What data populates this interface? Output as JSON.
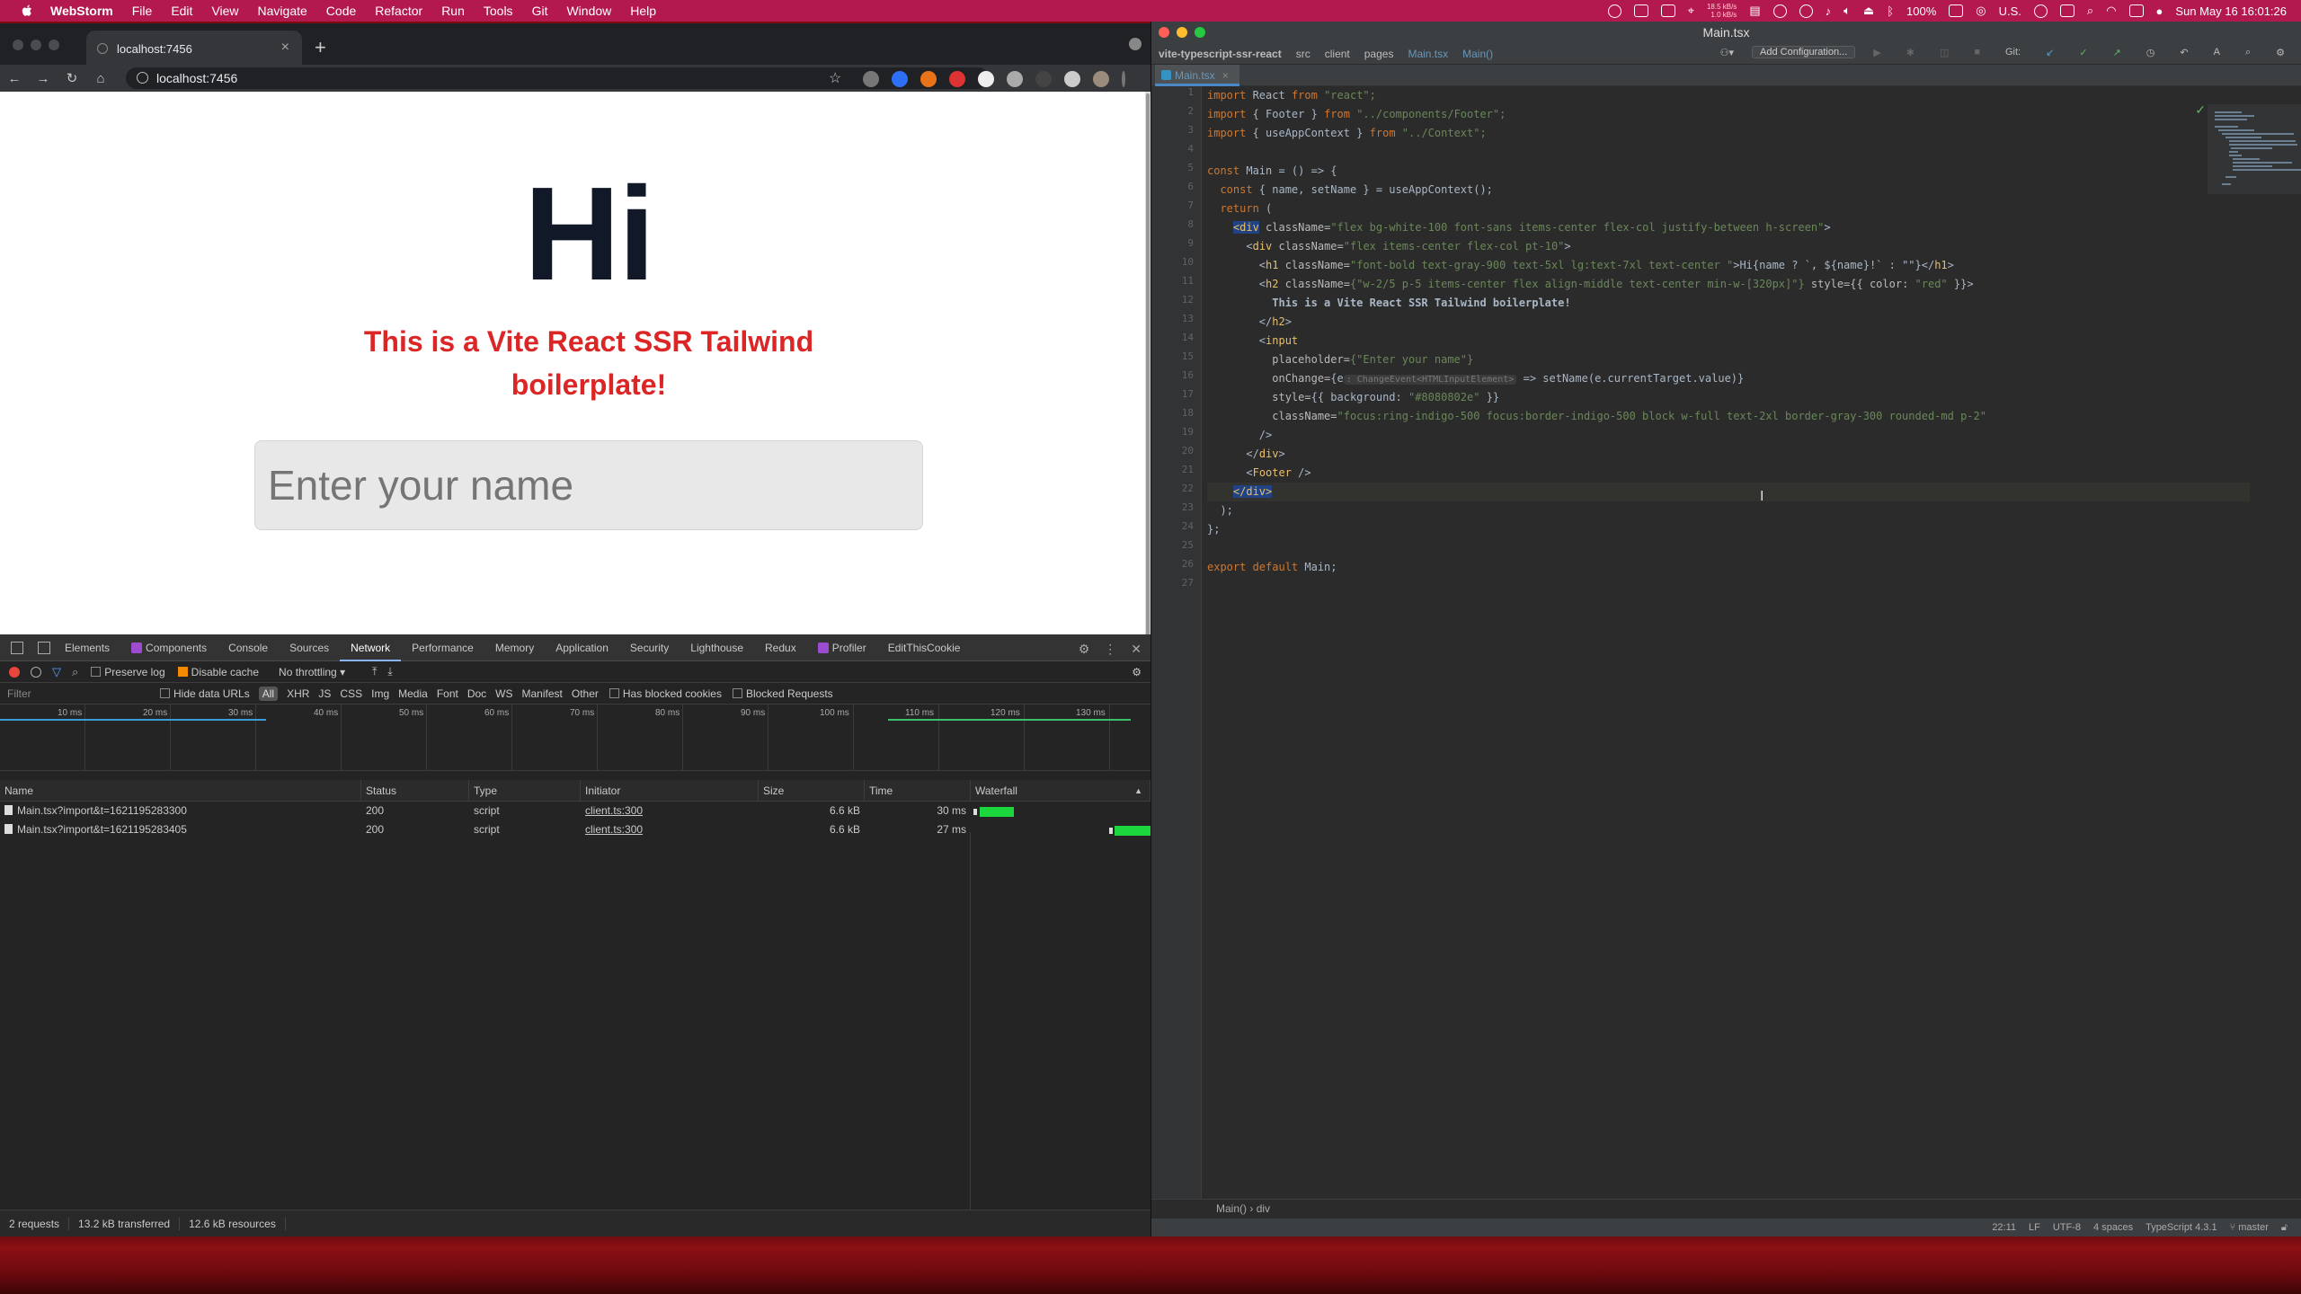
{
  "menubar": {
    "app": "WebStorm",
    "items": [
      "File",
      "Edit",
      "View",
      "Navigate",
      "Code",
      "Refactor",
      "Run",
      "Tools",
      "Git",
      "Window",
      "Help"
    ],
    "net_speed": [
      "18.5 kB/s",
      "1.0 kB/s"
    ],
    "battery": "100%",
    "input_source": "U.S.",
    "clock": "Sun May 16 16:01:26"
  },
  "browser": {
    "tab_title": "localhost:7456",
    "url": "localhost:7456",
    "page": {
      "heading": "Hi",
      "subheading": "This is a Vite React SSR Tailwind boilerplate!",
      "input_placeholder": "Enter your name",
      "input_background": "#8080802e"
    }
  },
  "devtools": {
    "tabs": [
      "Elements",
      "Components",
      "Console",
      "Sources",
      "Network",
      "Performance",
      "Memory",
      "Application",
      "Security",
      "Lighthouse",
      "Redux",
      "Profiler",
      "EditThisCookie"
    ],
    "active_tab": "Network",
    "controls": {
      "preserve_log": "Preserve log",
      "disable_cache": "Disable cache",
      "throttling": "No throttling"
    },
    "filter": {
      "placeholder": "Filter",
      "hide_data_urls": "Hide data URLs",
      "types": [
        "All",
        "XHR",
        "JS",
        "CSS",
        "Img",
        "Media",
        "Font",
        "Doc",
        "WS",
        "Manifest",
        "Other"
      ],
      "has_blocked_cookies": "Has blocked cookies",
      "blocked_requests": "Blocked Requests"
    },
    "timeline_ticks": [
      "10 ms",
      "20 ms",
      "30 ms",
      "40 ms",
      "50 ms",
      "60 ms",
      "70 ms",
      "80 ms",
      "90 ms",
      "100 ms",
      "110 ms",
      "120 ms",
      "130 ms"
    ],
    "columns": [
      "Name",
      "Status",
      "Type",
      "Initiator",
      "Size",
      "Time",
      "Waterfall"
    ],
    "requests": [
      {
        "name": "Main.tsx?import&t=1621195283300",
        "status": "200",
        "type": "script",
        "initiator": "client.ts:300",
        "size": "6.6 kB",
        "time": "30 ms"
      },
      {
        "name": "Main.tsx?import&t=1621195283405",
        "status": "200",
        "type": "script",
        "initiator": "client.ts:300",
        "size": "6.6 kB",
        "time": "27 ms"
      }
    ],
    "status": {
      "requests": "2 requests",
      "transferred": "13.2 kB transferred",
      "resources": "12.6 kB resources"
    }
  },
  "ide": {
    "window_title": "Main.tsx",
    "breadcrumbs": [
      "vite-typescript-ssr-react",
      "src",
      "client",
      "pages",
      "Main.tsx",
      "Main()"
    ],
    "add_configuration": "Add Configuration...",
    "git_label": "Git:",
    "file_tab": "Main.tsx",
    "line_numbers": [
      "1",
      "2",
      "3",
      "4",
      "5",
      "6",
      "7",
      "8",
      "9",
      "10",
      "11",
      "12",
      "13",
      "14",
      "15",
      "16",
      "17",
      "18",
      "19",
      "20",
      "21",
      "22",
      "23",
      "24",
      "25",
      "26",
      "27"
    ],
    "bottom_breadcrumb": [
      "Main()",
      "div"
    ],
    "status": {
      "position": "22:11",
      "line_sep": "LF",
      "encoding": "UTF-8",
      "indent": "4 spaces",
      "language": "TypeScript 4.3.1",
      "branch": "master"
    }
  },
  "code": {
    "l1": {
      "kw": "import",
      "id": " React ",
      "from": "from",
      "str": " \"react\";"
    },
    "l2": {
      "kw": "import",
      "id": " { Footer } ",
      "from": "from",
      "str": " \"../components/Footer\";"
    },
    "l3": {
      "kw": "import",
      "id": " { useAppContext } ",
      "from": "from",
      "str": " \"../Context\";"
    },
    "l5": {
      "kw": "const",
      "rest": " Main = () => {"
    },
    "l6": {
      "kw": "const",
      "rest": " { name, setName } = useAppContext();"
    },
    "l7": {
      "kw": "return",
      "rest": " ("
    },
    "l8": {
      "open": "<",
      "tag": "div",
      "attr": " className=",
      "val": "\"flex bg-white-100 font-sans items-center flex-col justify-between h-screen\"",
      "close": ">"
    },
    "l9": {
      "open": "<",
      "tag": "div",
      "attr": " className=",
      "val": "\"flex items-center flex-col pt-10\"",
      "close": ">"
    },
    "l10": {
      "open": "<",
      "tag": "h1",
      "attr": " className=",
      "val": "\"font-bold text-gray-900 text-5xl lg:text-7xl text-center \"",
      "mid": ">Hi{name ? `, ${name}!` : \"\"}</",
      "tag2": "h1",
      "close": ">"
    },
    "l11": {
      "open": "<",
      "tag": "h2",
      "attr": " className=",
      "val": "{\"w-2/5 p-5 items-center flex align-middle text-center min-w-[320px]\"}",
      "attr2": " style={{ color: ",
      "val2": "\"red\"",
      "close": " }}>"
    },
    "l12": {
      "text": "This is a Vite React SSR Tailwind boilerplate!"
    },
    "l13": {
      "open": "</",
      "tag": "h2",
      "close": ">"
    },
    "l14": {
      "open": "<",
      "tag": "input"
    },
    "l15": {
      "attr": "placeholder=",
      "val": "{\"Enter your name\"}"
    },
    "l16": {
      "attr": "onChange=",
      "pre": "{e",
      "hint": ": ChangeEvent<HTMLInputElement>",
      "post": " => setName(e.currentTarget.value)}"
    },
    "l17": {
      "attr": "style=",
      "pre": "{{ background: ",
      "val": "\"#8080802e\"",
      "post": " }}"
    },
    "l18": {
      "attr": "className=",
      "val": "\"focus:ring-indigo-500 focus:border-indigo-500 block w-full text-2xl border-gray-300 rounded-md p-2\""
    },
    "l19": {
      "text": "/>"
    },
    "l20": {
      "open": "</",
      "tag": "div",
      "close": ">"
    },
    "l21": {
      "open": "<",
      "tag": "Footer",
      "close": " />"
    },
    "l22": {
      "open": "</",
      "tag": "div",
      "close": ">"
    },
    "l23": {
      "text": ");"
    },
    "l24": {
      "text": "};"
    },
    "l26": {
      "kw": "export default",
      "rest": " Main;"
    }
  }
}
